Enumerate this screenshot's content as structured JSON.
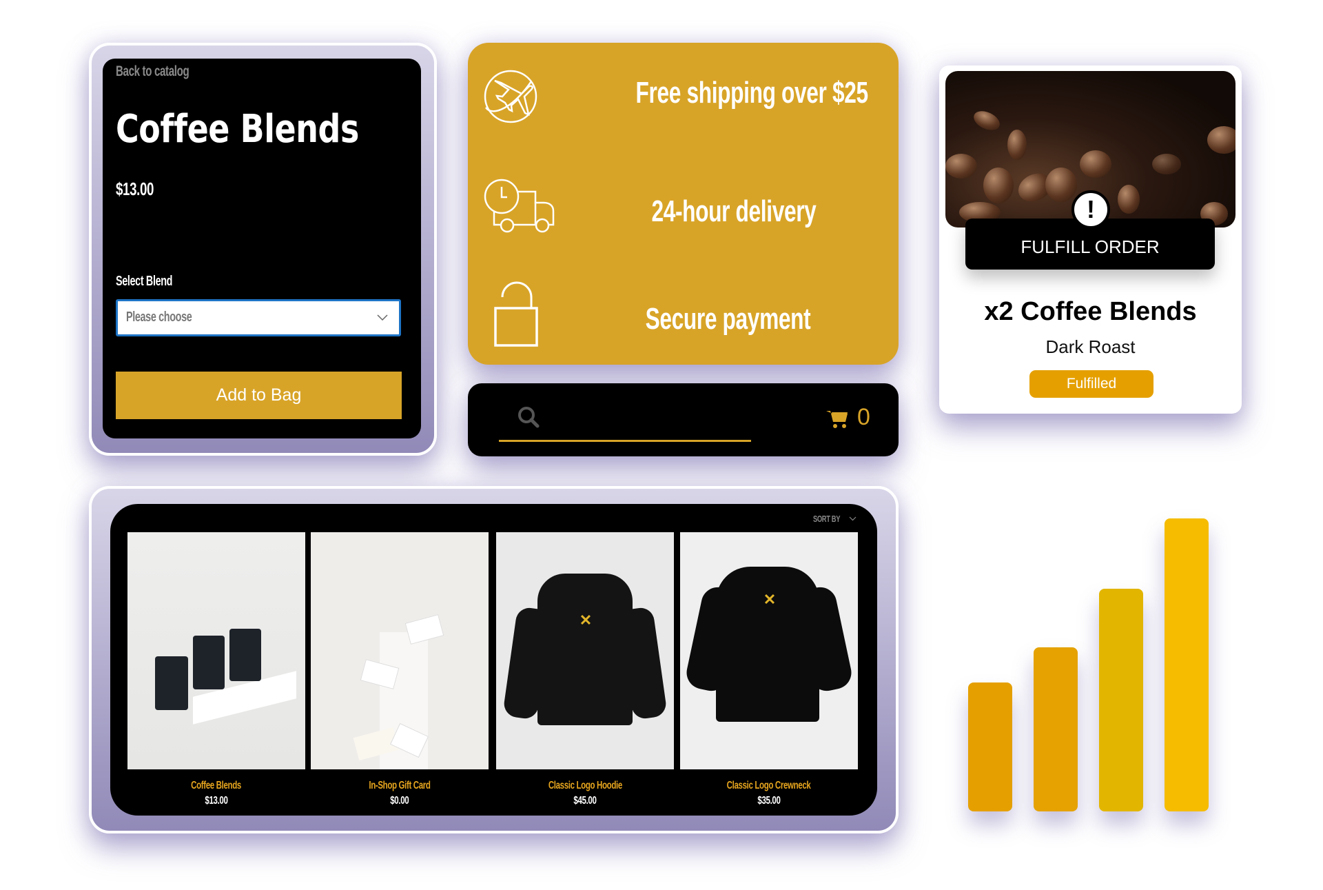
{
  "product_card": {
    "back_link": "Back to catalog",
    "title": "Coffee Blends",
    "price": "$13.00",
    "select_label": "Select Blend",
    "select_placeholder": "Please choose",
    "add_button": "Add to Bag"
  },
  "perks": [
    {
      "icon": "plane-globe-icon",
      "text": "Free shipping over $25"
    },
    {
      "icon": "delivery-truck-clock-icon",
      "text": "24-hour delivery"
    },
    {
      "icon": "unlocked-padlock-icon",
      "text": "Secure payment"
    }
  ],
  "search_bar": {
    "search_icon": "search-icon",
    "cart_icon": "cart-icon",
    "cart_count": "0"
  },
  "order_card": {
    "banner": "FULFILL ORDER",
    "alert_icon": "exclamation-icon",
    "title": "x2 Coffee Blends",
    "subtitle": "Dark Roast",
    "status": "Fulfilled"
  },
  "catalog": {
    "sort_label": "SORT BY",
    "products": [
      {
        "name": "Coffee Blends",
        "price": "$13.00"
      },
      {
        "name": "In-Shop Gift Card",
        "price": "$0.00"
      },
      {
        "name": "Classic Logo Hoodie",
        "price": "$45.00"
      },
      {
        "name": "Classic Logo Crewneck",
        "price": "$35.00"
      }
    ]
  },
  "decor_bars": {
    "levels": [
      0.44,
      0.56,
      0.76,
      1.0
    ],
    "colors": [
      "#e5a000",
      "#e5a200",
      "#e2b600",
      "#f5bc00"
    ]
  },
  "colors": {
    "accent": "#d8a428",
    "dark": "#000000",
    "focus": "#1e74c6",
    "status": "#e5a000"
  }
}
